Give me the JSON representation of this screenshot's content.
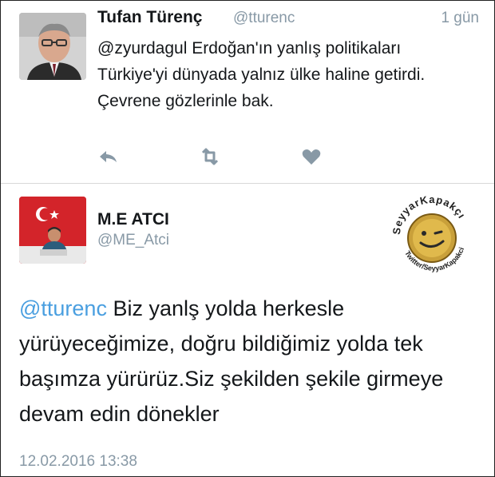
{
  "tweet1": {
    "name": "Tufan Türenç",
    "handle": "@tturenc",
    "time": "1 gün",
    "text": "@zyurdagul Erdoğan'ın yanlış politikaları Türkiye'yi dünyada yalnız ülke haline getirdi. Çevrene gözlerinle bak.",
    "actions": [
      "reply-icon",
      "retweet-icon",
      "like-icon"
    ]
  },
  "tweet2": {
    "name": "M.E ATCI",
    "handle": "@ME_Atci",
    "mention": "@tturenc",
    "text": " Biz yanlş yolda herkesle yürüyeceğimize, doğru bildiğimiz yolda tek başımza yürürüz.Siz şekilden şekile girmeye devam edin dönekler",
    "date": "12.02.2016 13:38"
  },
  "watermark": {
    "top_text": "SeyyarKapakçı",
    "bottom_text": "Twitter/SeyyarKapakci"
  },
  "colors": {
    "link": "#4a9fe0",
    "muted": "#8899a6",
    "text": "#14171a"
  }
}
